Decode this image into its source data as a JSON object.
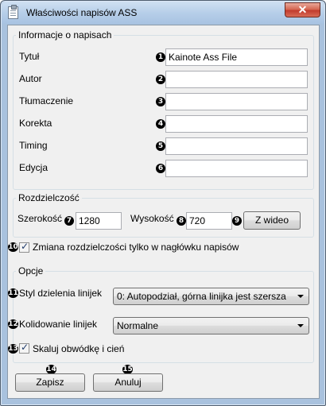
{
  "window": {
    "title": "Właściwości napisów ASS",
    "close_label": "✕"
  },
  "info_group": {
    "title": "Informacje o napisach",
    "fields": [
      {
        "num": "1",
        "label": "Tytuł",
        "value": "Kainote Ass File"
      },
      {
        "num": "2",
        "label": "Autor",
        "value": ""
      },
      {
        "num": "3",
        "label": "Tłumaczenie",
        "value": ""
      },
      {
        "num": "4",
        "label": "Korekta",
        "value": ""
      },
      {
        "num": "5",
        "label": "Timing",
        "value": ""
      },
      {
        "num": "6",
        "label": "Edycja",
        "value": ""
      }
    ]
  },
  "resolution_group": {
    "title": "Rozdzielczość",
    "width_label": "Szerokość",
    "width_num": "7",
    "width_value": "1280",
    "height_label": "Wysokość",
    "height_num": "8",
    "height_value": "720",
    "from_video_num": "9",
    "from_video_label": "Z wideo"
  },
  "resolution_header_only": {
    "num": "10",
    "label": "Zmiana rozdzielczości tylko w nagłówku napisów",
    "checked": true
  },
  "options_group": {
    "title": "Opcje",
    "wrap_style": {
      "num": "11",
      "label": "Styl dzielenia linijek",
      "value": "0: Autopodział, górna linijka jest szersza"
    },
    "collision": {
      "num": "12",
      "label": "Kolidowanie linijek",
      "value": "Normalne"
    },
    "scale_border": {
      "num": "13",
      "label": "Skaluj obwódkę i cień",
      "checked": true
    }
  },
  "buttons": {
    "save_num": "14",
    "save_label": "Zapisz",
    "cancel_num": "15",
    "cancel_label": "Anuluj"
  }
}
